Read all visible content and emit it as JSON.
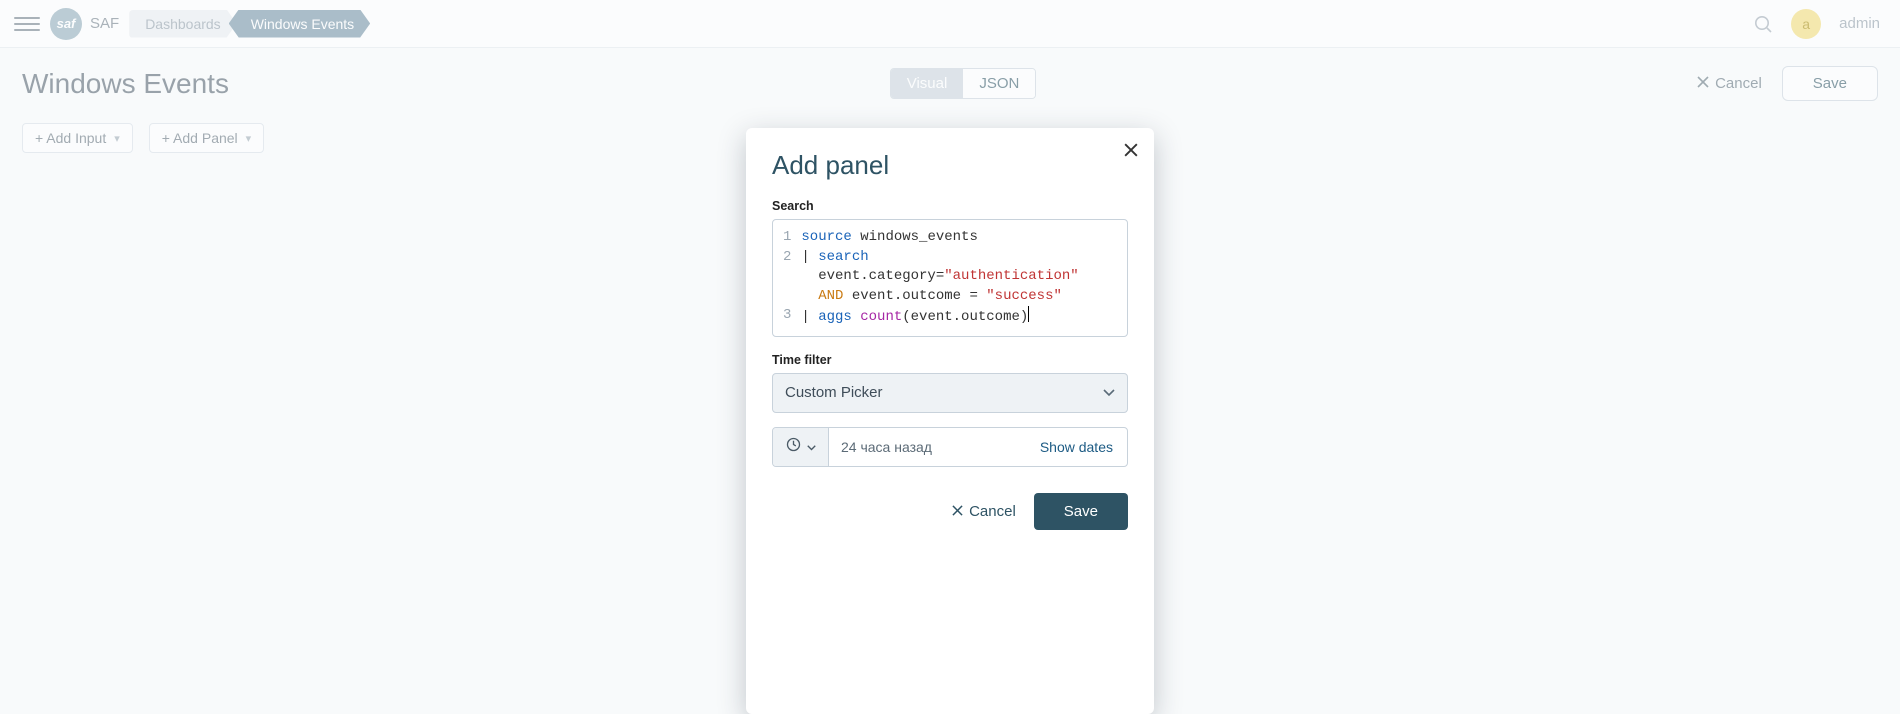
{
  "brand": {
    "logo_text": "saf",
    "name": "SAF"
  },
  "breadcrumb": {
    "level1": "Dashboards",
    "level2": "Windows Events"
  },
  "user": {
    "avatar_initial": "a",
    "name": "admin"
  },
  "page": {
    "title": "Windows Events",
    "view_tabs": {
      "visual": "Visual",
      "json": "JSON"
    },
    "cancel": "Cancel",
    "save": "Save",
    "toolbar": {
      "add_input": "+ Add Input",
      "add_panel": "+ Add Panel"
    }
  },
  "modal": {
    "title": "Add panel",
    "search_label": "Search",
    "query": {
      "line1": {
        "kw": "source",
        "rest": "windows_events"
      },
      "line2": {
        "pipe": "|",
        "kw": "search",
        "cont1_pre": "event.category=",
        "cont1_str": "\"authentication\"",
        "cont2_and": "AND",
        "cont2_mid": "event.outcome = ",
        "cont2_str": "\"success\""
      },
      "line3": {
        "pipe": "|",
        "kw1": "aggs",
        "kw2": "count",
        "rest": "(event.outcome)"
      }
    },
    "time_filter_label": "Time filter",
    "time_filter_value": "Custom Picker",
    "date_text": "24 часа назад",
    "show_dates": "Show dates",
    "cancel": "Cancel",
    "save": "Save"
  }
}
